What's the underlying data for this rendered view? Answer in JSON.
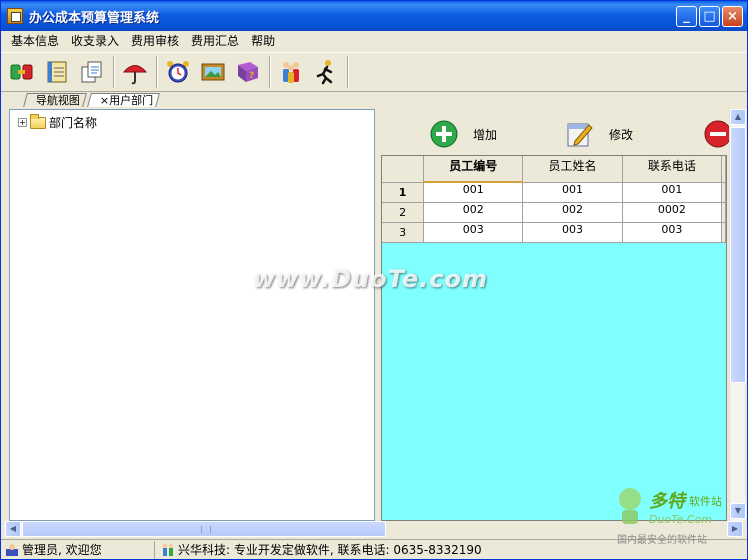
{
  "window": {
    "title": "办公成本预算管理系统",
    "controls": [
      "_",
      "□",
      "×"
    ]
  },
  "menu": [
    "基本信息",
    "收支录入",
    "费用审核",
    "费用汇总",
    "帮助"
  ],
  "toolbar": {
    "icons": [
      "switch-icon",
      "notebook-icon",
      "documents-icon",
      "umbrella-icon",
      "alarm-clock-icon",
      "picture-icon",
      "help-book-icon",
      "users-icon",
      "exit-runner-icon"
    ],
    "colors": {
      "green": "#2FA84A",
      "red": "#D8232A",
      "purple": "#7B3F9E",
      "gold": "#E6B422"
    }
  },
  "tabs": [
    {
      "label": "导航视图",
      "active": false
    },
    {
      "label": "×用户部门",
      "active": true
    }
  ],
  "tree": {
    "expander": "+",
    "root_label": "部门名称"
  },
  "actions": {
    "add_label": "增加",
    "edit_label": "修改"
  },
  "grid": {
    "columns": [
      "员工编号",
      "员工姓名",
      "联系电话"
    ],
    "rows": [
      {
        "num": "1",
        "cells": [
          "001",
          "001",
          "001"
        ]
      },
      {
        "num": "2",
        "cells": [
          "002",
          "002",
          "0002"
        ]
      },
      {
        "num": "3",
        "cells": [
          "003",
          "003",
          "003"
        ]
      }
    ],
    "empty_color": "#80FFFF"
  },
  "statusbar": {
    "user": "管理员, 欢迎您",
    "company": "兴华科技: 专业开发定做软件, 联系电话: 0635-8332190"
  },
  "watermark": {
    "text": "www.DuoTe.com",
    "logo_name": "多特",
    "logo_sub": "软件站",
    "logo_url": "DuoTe.Com",
    "logo_tag": "国内最安全的软件站"
  }
}
